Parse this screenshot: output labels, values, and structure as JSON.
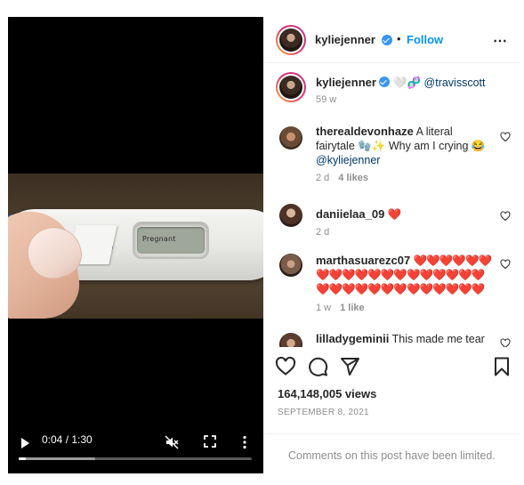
{
  "video": {
    "test_display_text": "Pregnant",
    "time": "0:04 / 1:30",
    "progress_played": 0.03,
    "progress_buffered": 0.33
  },
  "post_header": {
    "username": "kyliejenner",
    "dot": "•",
    "follow_label": "Follow",
    "menu_label": "⋯"
  },
  "caption": {
    "username": "kyliejenner",
    "emoji": "🤍🧬",
    "mention": "@travisscott",
    "age": "59 w"
  },
  "comments": [
    {
      "username": "therealdevonhaze",
      "text": "A literal fairytale 🧤✨ Why am I crying 😂",
      "mention": "@kyliejenner",
      "age": "2 d",
      "likes": "4 likes"
    },
    {
      "username": "daniielaa_09",
      "text": "❤️",
      "age": "2 d"
    },
    {
      "username": "marthasuarezc07",
      "text": "❤️❤️❤️❤️❤️❤️❤️❤️❤️❤️❤️❤️❤️❤️❤️❤️❤️❤️❤️❤️❤️❤️❤️❤️❤️❤️❤️❤️❤️❤️❤️❤️",
      "age": "1 w",
      "likes": "1 like"
    },
    {
      "username": "lilladygeminii",
      "text": "This made me tear"
    }
  ],
  "stats": {
    "views": "164,148,005 views",
    "date": "SEPTEMBER 8, 2021"
  },
  "footer": {
    "limited_text": "Comments on this post have been limited."
  },
  "icons": {
    "like": "heart-icon",
    "comment": "comment-icon",
    "share": "paper-plane-icon",
    "save": "bookmark-icon"
  },
  "colors": {
    "link_blue": "#0095f6",
    "verified_blue": "#3897f0",
    "heart_red": "#ed4956",
    "muted_text": "#8e8e8e"
  }
}
